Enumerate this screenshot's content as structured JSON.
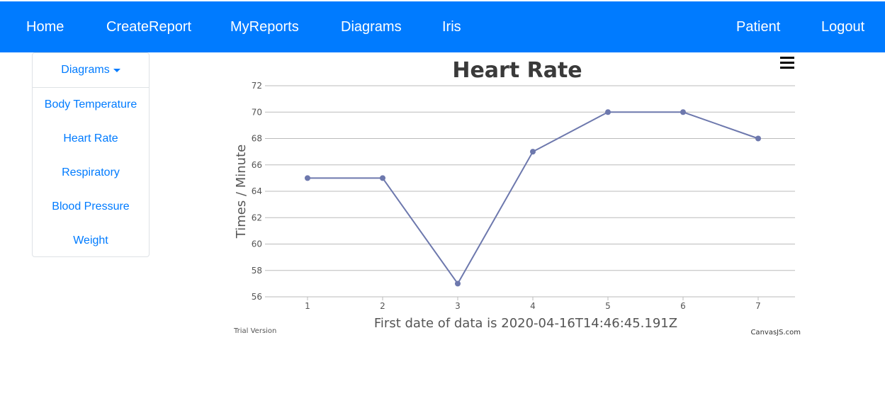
{
  "nav": {
    "left": [
      "Home",
      "CreateReport",
      "MyReports",
      "Diagrams",
      "Iris"
    ],
    "right": [
      "Patient",
      "Logout"
    ]
  },
  "sidebar": {
    "header": "Diagrams",
    "items": [
      "Body Temperature",
      "Heart Rate",
      "Respiratory",
      "Blood Pressure",
      "Weight"
    ]
  },
  "chart_watermarks": {
    "trial": "Trial Version",
    "credit": "CanvasJS.com"
  },
  "chart_data": {
    "type": "line",
    "title": "Heart Rate",
    "xlabel": "First date of data is 2020-04-16T14:46:45.191Z",
    "ylabel": "Times  / Minute",
    "x": [
      1,
      2,
      3,
      4,
      5,
      6,
      7
    ],
    "values": [
      65,
      65,
      57,
      67,
      70,
      70,
      68
    ],
    "ylim": [
      56,
      72
    ],
    "yticks": [
      56,
      58,
      60,
      62,
      64,
      66,
      68,
      70,
      72
    ],
    "xticks": [
      1,
      2,
      3,
      4,
      5,
      6,
      7
    ],
    "grid": true,
    "colors": {
      "line": "#6d78ad",
      "grid": "#bbbbbb",
      "title": "#3a3a3a",
      "axis_text": "#555555"
    }
  }
}
